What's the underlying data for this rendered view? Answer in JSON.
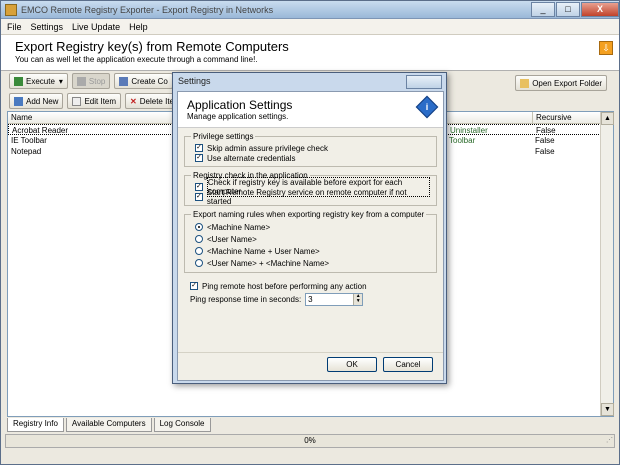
{
  "window": {
    "title": "EMCO Remote Registry Exporter - Export Registry in Networks",
    "min": "_",
    "max": "□",
    "close": "X"
  },
  "menu": [
    "File",
    "Settings",
    "Live Update",
    "Help"
  ],
  "header": {
    "title": "Export Registry key(s) from Remote Computers",
    "subtitle": "You can as well let the application execute through a command line!."
  },
  "toolbar1": {
    "execute": "Execute",
    "stop": "Stop",
    "create": "Create Co",
    "open_export": "Open Export Folder"
  },
  "toolbar2": {
    "add": "Add New",
    "edit": "Edit Item",
    "delete": "Delete Item"
  },
  "grid": {
    "columns": [
      "Name",
      "Recursive"
    ],
    "rows": [
      {
        "name": "Acrobat Reader",
        "frag": "Uninstaller",
        "recursive": "False"
      },
      {
        "name": "IE Toolbar",
        "frag": "Toolbar",
        "recursive": "False"
      },
      {
        "name": "Notepad",
        "frag": "",
        "recursive": "False"
      }
    ]
  },
  "tabs": [
    "Registry Info",
    "Available Computers",
    "Log Console"
  ],
  "status": {
    "progress": "0%"
  },
  "dialog": {
    "window_title": "Settings",
    "title": "Application Settings",
    "subtitle": "Manage application settings.",
    "privilege": {
      "legend": "Privilege settings",
      "skip": "Skip admin assure privilege check",
      "alt": "Use alternate credentials"
    },
    "registry": {
      "legend": "Registry check in the application",
      "check": "Check if registry key is available before export for each computer",
      "start": "Start Remote Registry service on remote computer if not started"
    },
    "naming": {
      "legend": "Export naming rules when exporting registry key from a computer",
      "opts": [
        "<Machine Name>",
        "<User Name>",
        "<Machine Name + User Name>",
        "<User Name> + <Machine Name>"
      ]
    },
    "ping_label": "Ping remote host before performing any action",
    "ping_time_label": "Ping response time in seconds:",
    "ping_time_value": "3",
    "ok": "OK",
    "cancel": "Cancel"
  }
}
